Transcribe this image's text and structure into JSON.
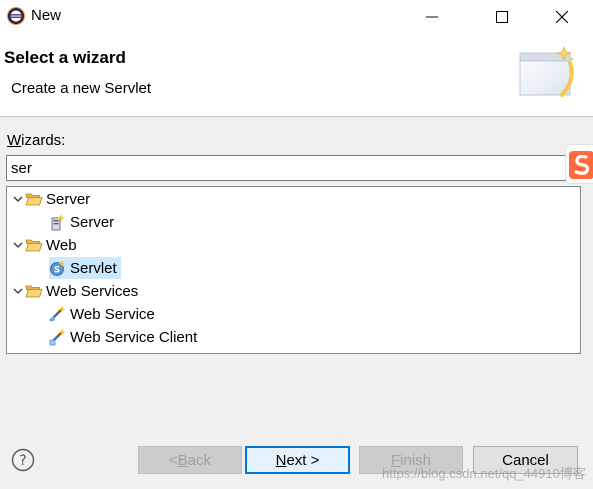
{
  "window": {
    "title": "New",
    "icon": "eclipse-icon",
    "controls": [
      "minimize-icon",
      "maximize-icon",
      "close-icon"
    ]
  },
  "banner": {
    "title": "Select a wizard",
    "subtitle": "Create a new Servlet",
    "image": "wizard-banner-icon"
  },
  "filter": {
    "label_mnemonic": "W",
    "label_rest": "izards:",
    "value": "ser"
  },
  "tree": {
    "items": [
      {
        "label": "Server",
        "type": "folder",
        "expanded": true,
        "icon": "folder-open-icon"
      },
      {
        "label": "Server",
        "type": "item",
        "icon": "server-wizard-icon"
      },
      {
        "label": "Web",
        "type": "folder",
        "expanded": true,
        "icon": "folder-open-icon"
      },
      {
        "label": "Servlet",
        "type": "item",
        "icon": "servlet-icon",
        "selected": true
      },
      {
        "label": "Web Services",
        "type": "folder",
        "expanded": true,
        "icon": "folder-open-icon"
      },
      {
        "label": "Web Service",
        "type": "item",
        "icon": "web-service-icon"
      },
      {
        "label": "Web Service Client",
        "type": "item",
        "icon": "web-service-client-icon"
      }
    ]
  },
  "buttons": {
    "back": {
      "prefix": "< ",
      "mnemonic": "B",
      "rest": "ack",
      "enabled": false
    },
    "next": {
      "mnemonic": "N",
      "rest": "ext >",
      "enabled": true,
      "default": true
    },
    "finish": {
      "mnemonic": "F",
      "rest": "inish",
      "enabled": false
    },
    "cancel": {
      "label": "Cancel",
      "enabled": true
    }
  },
  "help": {
    "icon": "help-icon"
  },
  "watermark": {
    "text": "https://blog.csdn.net/qq_44910博客"
  },
  "colors": {
    "selection": "#cce8ff",
    "folder": "#e8b84a",
    "default_button_border": "#0078d7",
    "ime_badge": "#ff6a3d"
  }
}
